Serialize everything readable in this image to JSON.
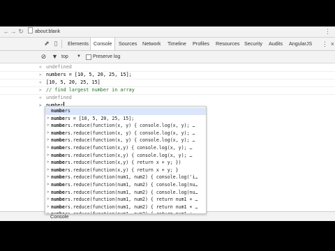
{
  "browser": {
    "url": "about:blank"
  },
  "devtools": {
    "tabs": [
      "Elements",
      "Console",
      "Sources",
      "Network",
      "Timeline",
      "Profiles",
      "Resources",
      "Security",
      "Audits",
      "AngularJS"
    ],
    "active_tab": "Console",
    "more_icon": "»"
  },
  "toolbar": {
    "context": "top",
    "preserve_log_label": "Preserve log",
    "preserve_log_checked": false
  },
  "console": {
    "lines": [
      {
        "glyph": "<",
        "text": "undefined",
        "style": "grey"
      },
      {
        "glyph": ">",
        "text": "numbers = [10, 5, 20, 25, 15];",
        "style": "code"
      },
      {
        "glyph": "<",
        "text": "[10, 5, 20, 25, 15]",
        "style": "code"
      },
      {
        "glyph": ">",
        "text": "// find largest number in array",
        "style": "green"
      },
      {
        "glyph": "<",
        "text": "undefined",
        "style": "grey"
      }
    ],
    "prompt_input": "number"
  },
  "autocomplete": {
    "typed": "numbe",
    "items": [
      {
        "arrow": "",
        "text": "numbers",
        "selected": true
      },
      {
        "arrow": ">",
        "text": "numbers = [10, 5, 20, 25, 15];"
      },
      {
        "arrow": ">",
        "text": "numbers.reduce(function(x, y) { console.log(x, y); …"
      },
      {
        "arrow": ">",
        "text": "numbers.reduce(function(x, y) { console.log(x, y); …"
      },
      {
        "arrow": ">",
        "text": "numbers.reduce(function(x, y) { console.log(x, y); …"
      },
      {
        "arrow": ">",
        "text": "numbers.reduce(function(x,y) { console.log(x, y); …"
      },
      {
        "arrow": ">",
        "text": "numbers.reduce(function(x,y) { console.log(x, y); …"
      },
      {
        "arrow": ">",
        "text": "numbers.reduce(function(x,y) { return x + y; })"
      },
      {
        "arrow": ">",
        "text": "numbers.reduce(function(x,y) { return x + y; }"
      },
      {
        "arrow": ">",
        "text": "numbers.reduce(function(num1, num2) { console.log('i…"
      },
      {
        "arrow": ">",
        "text": "numbers.reduce(function(num1, num2) { console.log(nu…"
      },
      {
        "arrow": ">",
        "text": "numbers.reduce(function(num1, num2) { console.log(nu…"
      },
      {
        "arrow": ">",
        "text": "numbers.reduce(function(num1, num2) { return num1 + …"
      },
      {
        "arrow": ">",
        "text": "numbers.reduce(function(num1, num2) { return num1 + …"
      },
      {
        "arrow": ">",
        "text": "numbers.reduce(function(num1, num2) { return num1 + …"
      },
      {
        "arrow": ">",
        "text": "numbers.reduce(function(num1, num2) { return num1 + …"
      }
    ]
  },
  "drawer": {
    "label": "Console"
  }
}
